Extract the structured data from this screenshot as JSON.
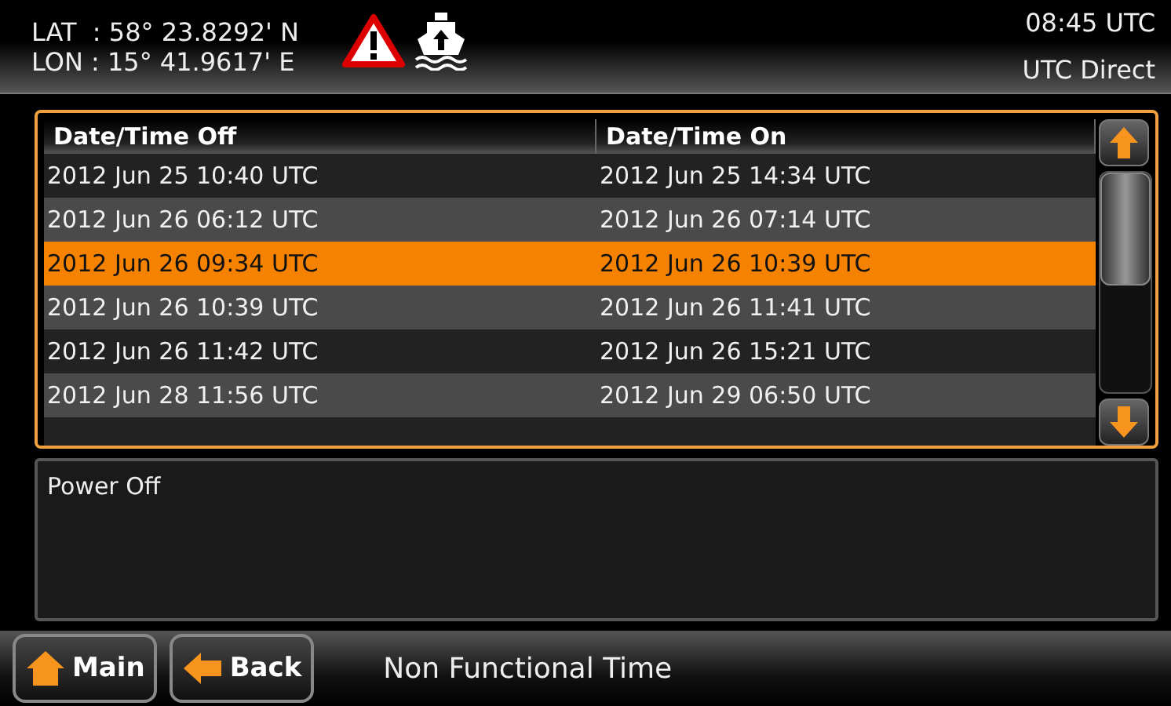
{
  "header": {
    "lat": "LAT  : 58° 23.8292' N",
    "lon": "LON : 15° 41.9617' E",
    "time": "08:45 UTC",
    "mode": "UTC Direct"
  },
  "table": {
    "columns": [
      "Date/Time Off",
      "Date/Time On"
    ],
    "rows": [
      {
        "off": "2012 Jun 25 10:40 UTC",
        "on": "2012 Jun 25 14:34 UTC",
        "selected": false
      },
      {
        "off": "2012 Jun 26 06:12 UTC",
        "on": "2012 Jun 26 07:14 UTC",
        "selected": false
      },
      {
        "off": "2012 Jun 26 09:34 UTC",
        "on": "2012 Jun 26 10:39 UTC",
        "selected": true
      },
      {
        "off": "2012 Jun 26 10:39 UTC",
        "on": "2012 Jun 26 11:41 UTC",
        "selected": false
      },
      {
        "off": "2012 Jun 26 11:42 UTC",
        "on": "2012 Jun 26 15:21 UTC",
        "selected": false
      },
      {
        "off": "2012 Jun 28 11:56 UTC",
        "on": "2012 Jun 29 06:50 UTC",
        "selected": false
      }
    ]
  },
  "description": "Power Off",
  "footer": {
    "buttons": [
      {
        "kind": "home",
        "label": "Main"
      },
      {
        "kind": "back",
        "label": "Back"
      }
    ],
    "title": "Non Functional Time"
  }
}
